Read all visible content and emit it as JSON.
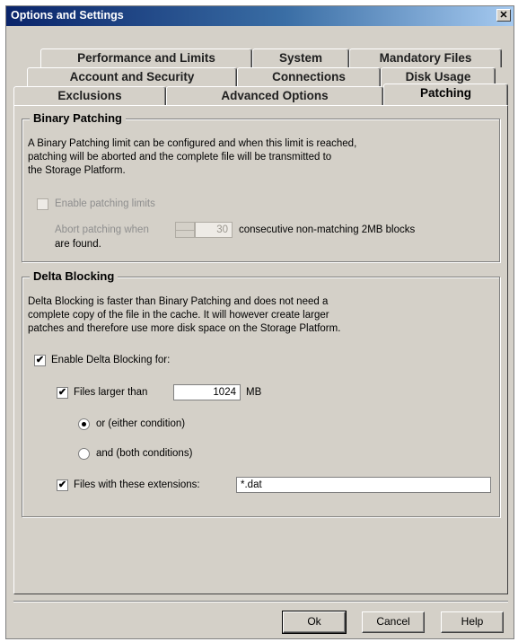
{
  "window": {
    "title": "Options and Settings",
    "close_glyph": "✕"
  },
  "tabs": {
    "row1": [
      "Performance and Limits",
      "System",
      "Mandatory Files"
    ],
    "row2": [
      "Account and Security",
      "Connections",
      "Disk Usage"
    ],
    "row3": [
      "Exclusions",
      "Advanced Options",
      "Patching"
    ],
    "active": "Patching"
  },
  "binary_patching": {
    "title": "Binary Patching",
    "description_lines": [
      "A Binary Patching limit can be configured and when this limit is reached,",
      "patching will be aborted and the complete file will be transmitted to",
      "the Storage Platform."
    ],
    "enable_label": "Enable patching limits",
    "enable_checked": false,
    "abort_prefix": "Abort patching when",
    "abort_value": "30",
    "abort_suffix": "consecutive non-matching 2MB blocks",
    "abort_suffix2": "are found."
  },
  "delta_blocking": {
    "title": "Delta Blocking",
    "description_lines": [
      "Delta Blocking is faster than Binary Patching and does not need a",
      "complete copy of the file in the cache. It will however create larger",
      "patches and therefore use more disk space on the Storage Platform."
    ],
    "enable_label": "Enable Delta Blocking for:",
    "enable_checked": true,
    "files_larger_label": "Files larger than",
    "files_larger_checked": true,
    "files_larger_value": "1024",
    "files_larger_unit": "MB",
    "radio_or_label": "or (either condition)",
    "radio_and_label": "and (both conditions)",
    "radio_selected": "or",
    "extensions_label": "Files with these extensions:",
    "extensions_checked": true,
    "extensions_value": "*.dat",
    "check_glyph": "✔"
  },
  "buttons": {
    "ok": "Ok",
    "cancel": "Cancel",
    "help": "Help"
  },
  "colors": {
    "title_bar": "#0a246a",
    "dialog_face": "#d4d0c8"
  }
}
